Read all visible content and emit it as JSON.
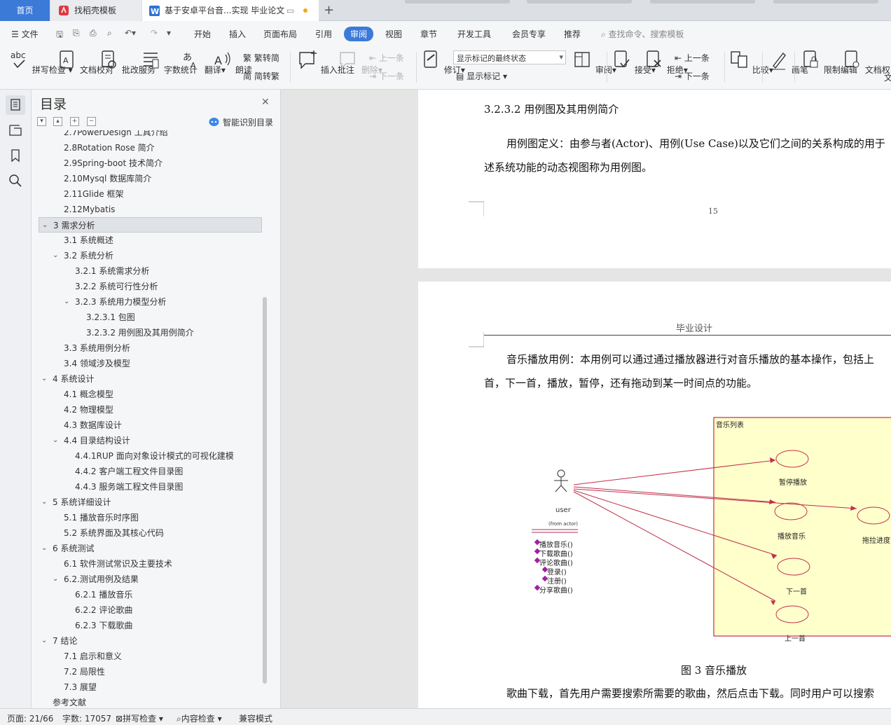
{
  "tabs": {
    "home": "首页",
    "template": "找稻壳模板",
    "document": "基于安卓平台音...实现 毕业论文",
    "add": "+"
  },
  "menu": {
    "file": "文件",
    "items": [
      "开始",
      "插入",
      "页面布局",
      "引用",
      "审阅",
      "视图",
      "章节",
      "开发工具",
      "会员专享",
      "推荐"
    ],
    "active": "审阅",
    "search_placeholder": "查找命令、搜索模板"
  },
  "ribbon": {
    "spell_check": "拼写检查",
    "doc_proofread": "文档校对",
    "batch_service": "批改服务",
    "word_count": "字数统计",
    "translate": "翻译",
    "read_aloud": "朗读",
    "to_traditional": "繁转简",
    "to_simplified": "简转繁",
    "insert_comment": "插入批注",
    "delete": "删除",
    "prev_comment": "上一条",
    "next_comment": "下一条",
    "track_changes": "修订",
    "markup_state": "显示标记的最终状态",
    "show_markup": "显示标记",
    "review": "审阅",
    "accept": "接受",
    "reject": "拒绝",
    "prev_change": "上一条",
    "next_change": "下一条",
    "compare": "比较",
    "ink": "画笔",
    "restrict_edit": "限制编辑",
    "doc_permission": "文档权限",
    "doc_cut": "文"
  },
  "toc": {
    "title": "目录",
    "smart": "智能识别目录",
    "items": [
      {
        "text": "2.7PowerDesign 工具介绍",
        "level": 2,
        "cut": true
      },
      {
        "text": "2.8Rotation Rose 简介",
        "level": 2
      },
      {
        "text": "2.9Spring-boot 技术简介",
        "level": 2
      },
      {
        "text": "2.10Mysql 数据库简介",
        "level": 2
      },
      {
        "text": "2.11Glide 框架",
        "level": 2
      },
      {
        "text": "2.12Mybatis",
        "level": 2
      },
      {
        "text": "3 需求分析",
        "level": 1,
        "chev": true,
        "sel": true
      },
      {
        "text": "3.1 系统概述",
        "level": 2
      },
      {
        "text": "3.2 系统分析",
        "level": 2,
        "chev": true
      },
      {
        "text": "3.2.1 系统需求分析",
        "level": 3
      },
      {
        "text": "3.2.2 系统可行性分析",
        "level": 3
      },
      {
        "text": "3.2.3 系统用力模型分析",
        "level": 3,
        "chev": true
      },
      {
        "text": "3.2.3.1 包图",
        "level": 4
      },
      {
        "text": "3.2.3.2 用例图及其用例简介",
        "level": 4
      },
      {
        "text": "3.3 系统用例分析",
        "level": 2
      },
      {
        "text": "3.4 领域涉及模型",
        "level": 2
      },
      {
        "text": "4 系统设计",
        "level": 1,
        "chev": true
      },
      {
        "text": "4.1 概念模型",
        "level": 2
      },
      {
        "text": "4.2 物理模型",
        "level": 2
      },
      {
        "text": "4.3  数据库设计",
        "level": 2
      },
      {
        "text": "4.4  目录结构设计",
        "level": 2,
        "chev": true
      },
      {
        "text": "4.4.1RUP 面向对象设计模式的可视化建模",
        "level": 3
      },
      {
        "text": "4.4.2 客户端工程文件目录图",
        "level": 3
      },
      {
        "text": "4.4.3 服务端工程文件目录图",
        "level": 3
      },
      {
        "text": "5 系统详细设计",
        "level": 1,
        "chev": true
      },
      {
        "text": "5.1 播放音乐时序图",
        "level": 2
      },
      {
        "text": "5.2 系统界面及其核心代码",
        "level": 2
      },
      {
        "text": "6 系统测试",
        "level": 1,
        "chev": true
      },
      {
        "text": "6.1  软件测试常识及主要技术",
        "level": 2
      },
      {
        "text": "6.2.测试用例及结果",
        "level": 2,
        "chev": true
      },
      {
        "text": "6.2.1 播放音乐",
        "level": 3
      },
      {
        "text": "6.2.2 评论歌曲",
        "level": 3
      },
      {
        "text": "6.2.3 下载歌曲",
        "level": 3
      },
      {
        "text": "7 结论",
        "level": 1,
        "chev": true
      },
      {
        "text": "7.1 启示和意义",
        "level": 2
      },
      {
        "text": "7.2 局限性",
        "level": 2
      },
      {
        "text": "7.3 展望",
        "level": 2
      },
      {
        "text": "参考文献",
        "level": 1,
        "cut": true
      }
    ]
  },
  "document": {
    "heading": "3.2.3.2 用例图及其用例简介",
    "def_line1": "用例图定义：由参与者(Actor)、用例(Use Case)以及它们之间的关系构成的用于",
    "def_line2": "述系统功能的动态视图称为用例图。",
    "page_number": "15",
    "header": "毕业设计",
    "para_line1": "音乐播放用例：本用例可以通过通过播放器进行对音乐播放的基本操作，包括上",
    "para_line2": "首，下一首，播放，暂停，还有拖动到某一时间点的功能。",
    "caption": "图  3 音乐播放",
    "bottom_line": "歌曲下载，首先用户需要搜索所需要的歌曲，然后点击下载。同时用户可以搜索"
  },
  "diagram": {
    "package": "音乐列表",
    "actor": "user",
    "actor_from": "(from actor)",
    "methods": [
      "播放音乐()",
      "下载歌曲()",
      "评论歌曲()",
      "登录()",
      "注册()",
      "分享歌曲()"
    ],
    "use_cases": [
      "暂停播放",
      "播放音乐",
      "拖拉进度",
      "下一首",
      "上一首"
    ],
    "colors": {
      "package_fill": "#ffffcc",
      "package_border": "#c0304a",
      "line": "#c0304a",
      "method_icon": "#a020a0"
    }
  },
  "status": {
    "page": "页面: 21/66",
    "words": "字数: 17057",
    "spell": "拼写检查",
    "content": "内容检查",
    "compat": "兼容模式"
  }
}
